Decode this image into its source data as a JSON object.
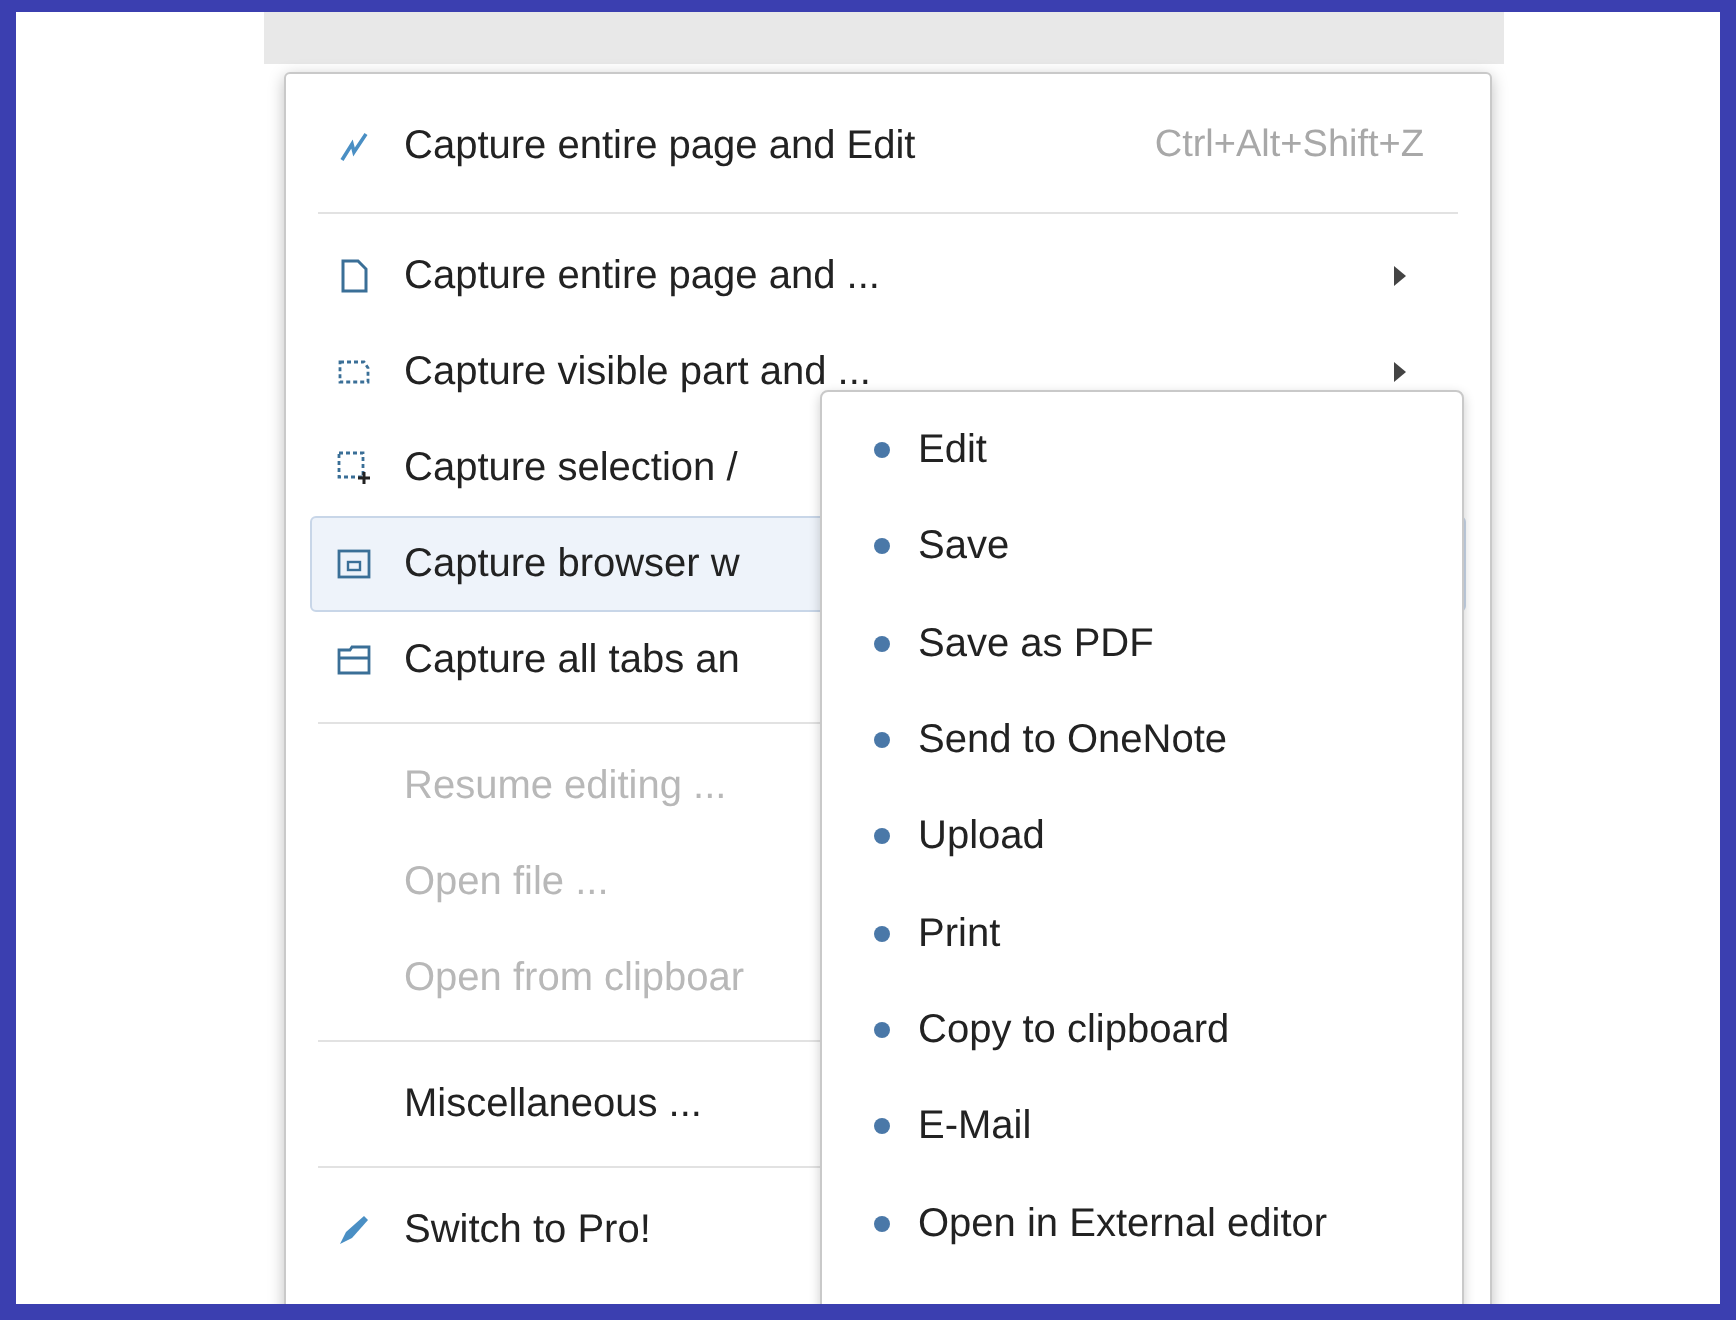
{
  "menu": {
    "groups": [
      [
        {
          "label": "Capture entire page and Edit",
          "shortcut": "Ctrl+Alt+Shift+Z",
          "has_submenu": false,
          "disabled": false,
          "selected": false
        }
      ],
      [
        {
          "label": "Capture entire page and ...",
          "has_submenu": true,
          "disabled": false,
          "selected": false
        },
        {
          "label": "Capture visible part and ...",
          "has_submenu": true,
          "disabled": false,
          "selected": false
        },
        {
          "label": "Capture selection /",
          "disabled": false,
          "selected": false
        },
        {
          "label": "Capture browser w",
          "disabled": false,
          "selected": true
        },
        {
          "label": "Capture all tabs an",
          "disabled": false,
          "selected": false
        }
      ],
      [
        {
          "label": "Resume editing ...",
          "disabled": true,
          "selected": false
        },
        {
          "label": "Open file ...",
          "disabled": true,
          "selected": false
        },
        {
          "label": "Open from clipboar",
          "disabled": true,
          "selected": false
        }
      ],
      [
        {
          "label": "Miscellaneous ...",
          "disabled": false,
          "selected": false
        }
      ],
      [
        {
          "label": "Switch to Pro!",
          "disabled": false,
          "selected": false
        }
      ]
    ]
  },
  "submenu": {
    "items": [
      {
        "label": "Edit"
      },
      {
        "label": "Save"
      },
      {
        "label": "Save as PDF"
      },
      {
        "label": "Send to OneNote"
      },
      {
        "label": "Upload"
      },
      {
        "label": "Print"
      },
      {
        "label": "Copy to clipboard"
      },
      {
        "label": "E-Mail"
      },
      {
        "label": "Open in External editor"
      }
    ]
  }
}
